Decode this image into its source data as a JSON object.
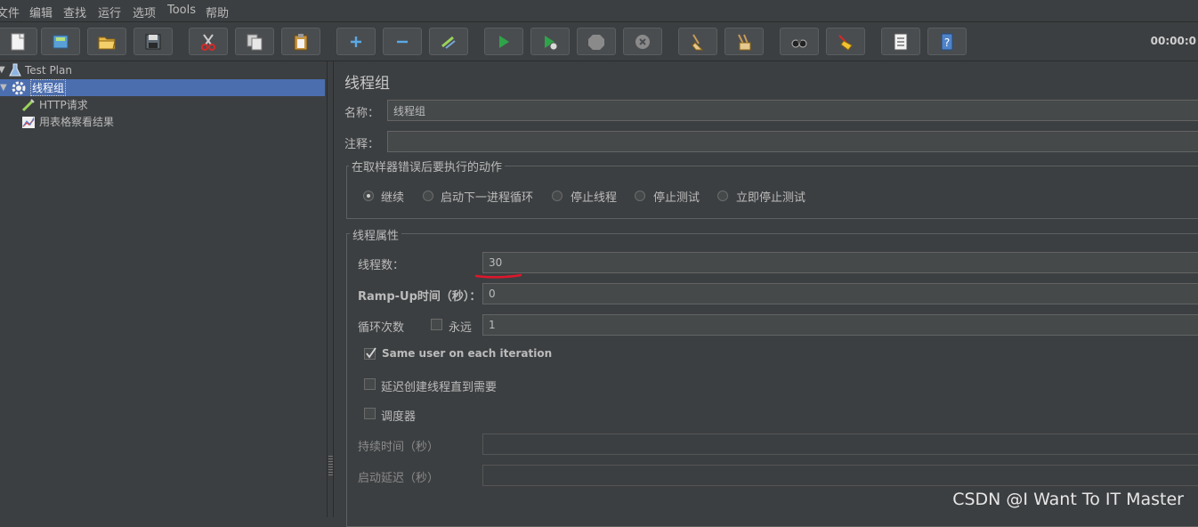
{
  "menu": [
    "文件",
    "编辑",
    "查找",
    "运行",
    "选项",
    "Tools",
    "帮助"
  ],
  "toolbar": {
    "buttons": [
      "new-icon",
      "templates-icon",
      "open-icon",
      "save-icon",
      "cut-icon",
      "copy-icon",
      "paste-icon",
      "expand-icon",
      "collapse-icon",
      "toggle-icon",
      "start-icon",
      "start-no-pause-icon",
      "stop-icon",
      "shutdown-icon",
      "clear-icon",
      "clear-all-icon",
      "search-icon",
      "reset-search-icon",
      "function-helper-icon",
      "help-icon"
    ],
    "timer": "00:00:0"
  },
  "tree": {
    "test_plan": "Test Plan",
    "thread_group": "线程组",
    "http_request": "HTTP请求",
    "results_table": "用表格察看结果"
  },
  "panel": {
    "title": "线程组",
    "name_label": "名称：",
    "name_value": "线程组",
    "comment_label": "注释：",
    "comment_value": "",
    "error_group_title": "在取样器错误后要执行的动作",
    "error_actions": [
      {
        "label": "继续",
        "selected": true
      },
      {
        "label": "启动下一进程循环",
        "selected": false
      },
      {
        "label": "停止线程",
        "selected": false
      },
      {
        "label": "停止测试",
        "selected": false
      },
      {
        "label": "立即停止测试",
        "selected": false
      }
    ],
    "props_group_title": "线程属性",
    "threads_label": "线程数：",
    "threads_value": "30",
    "rampup_label": "Ramp-Up时间（秒）：",
    "rampup_value": "0",
    "loop_label": "循环次数",
    "forever_label": "永远",
    "forever_checked": false,
    "loop_value": "1",
    "same_user_label": "Same user on each iteration",
    "same_user_checked": true,
    "delay_label": "延迟创建线程直到需要",
    "delay_checked": false,
    "scheduler_label": "调度器",
    "scheduler_checked": false,
    "duration_label": "持续时间（秒）",
    "duration_value": "",
    "startup_delay_label": "启动延迟（秒）",
    "startup_delay_value": ""
  },
  "watermark": "CSDN @I Want To IT Master",
  "colors": {
    "background": "#3c3f41",
    "selection": "#4b6eaf",
    "annotation_red": "#e0162b"
  }
}
